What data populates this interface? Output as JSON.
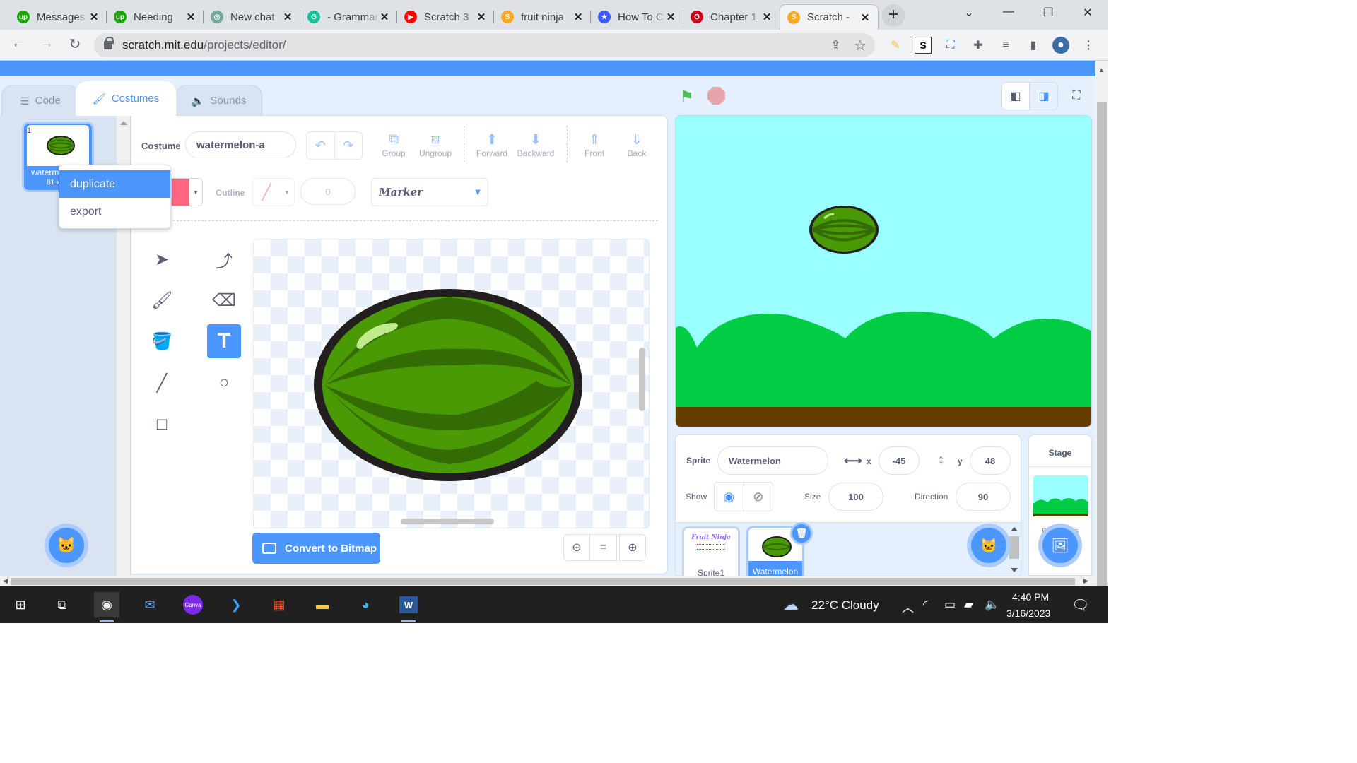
{
  "browser": {
    "tabs": [
      {
        "title": "Messages",
        "favicon": "upwork-icon",
        "color": "#14a800",
        "glyph": "up"
      },
      {
        "title": "Needing",
        "favicon": "upwork-icon",
        "color": "#14a800",
        "glyph": "up"
      },
      {
        "title": "New chat",
        "favicon": "chatgpt-icon",
        "color": "#74aa9c",
        "glyph": "◎"
      },
      {
        "title": "- Grammarly",
        "favicon": "grammarly-icon",
        "color": "#15c39a",
        "glyph": "G"
      },
      {
        "title": "Scratch 3",
        "favicon": "youtube-icon",
        "color": "#ff0000",
        "glyph": "▶"
      },
      {
        "title": "fruit ninja",
        "favicon": "scratch-icon",
        "color": "#f9a825",
        "glyph": "S"
      },
      {
        "title": "How To C",
        "favicon": "shield-icon",
        "color": "#3d5afe",
        "glyph": "★"
      },
      {
        "title": "Chapter 1",
        "favicon": "opera-icon",
        "color": "#d0021b",
        "glyph": "O"
      },
      {
        "title": "Scratch -",
        "favicon": "scratch-icon",
        "color": "#f9a825",
        "glyph": "S",
        "active": true
      }
    ],
    "url_domain": "scratch.mit.edu",
    "url_path": "/projects/editor/"
  },
  "editor": {
    "tabs": {
      "code": "Code",
      "costumes": "Costumes",
      "sounds": "Sounds"
    },
    "costume_item": {
      "number": "1",
      "name": "waterm",
      "size": "81 x"
    },
    "context_menu": {
      "duplicate": "duplicate",
      "export": "export"
    },
    "paint": {
      "costume_label": "Costume",
      "costume_name": "watermelon-a",
      "group": "Group",
      "ungroup": "Ungroup",
      "forward": "Forward",
      "backward": "Backward",
      "front": "Front",
      "back": "Back",
      "fill_color": "#ff6680",
      "outline_label": "Outline",
      "outline_width": "0",
      "font": "Marker",
      "selected_tool": "text",
      "convert_button": "Convert to Bitmap"
    }
  },
  "stage": {
    "sky_color": "#99ffff",
    "grass_color": "#00cc44",
    "ground_color": "#663d00"
  },
  "sprite_info": {
    "sprite_label": "Sprite",
    "sprite_name": "Watermelon",
    "x_label": "x",
    "x": "-45",
    "y_label": "y",
    "y": "48",
    "show_label": "Show",
    "size_label": "Size",
    "size": "100",
    "direction_label": "Direction",
    "direction": "90"
  },
  "sprites": [
    {
      "name": "Sprite1",
      "thumb_title": "Fruit Ninja"
    },
    {
      "name": "Watermelon",
      "selected": true
    }
  ],
  "stage_pane": {
    "label": "Stage",
    "backdrops_label": "Backdrops"
  },
  "taskbar": {
    "weather": "22°C  Cloudy",
    "time": "4:40 PM",
    "date": "3/16/2023"
  }
}
